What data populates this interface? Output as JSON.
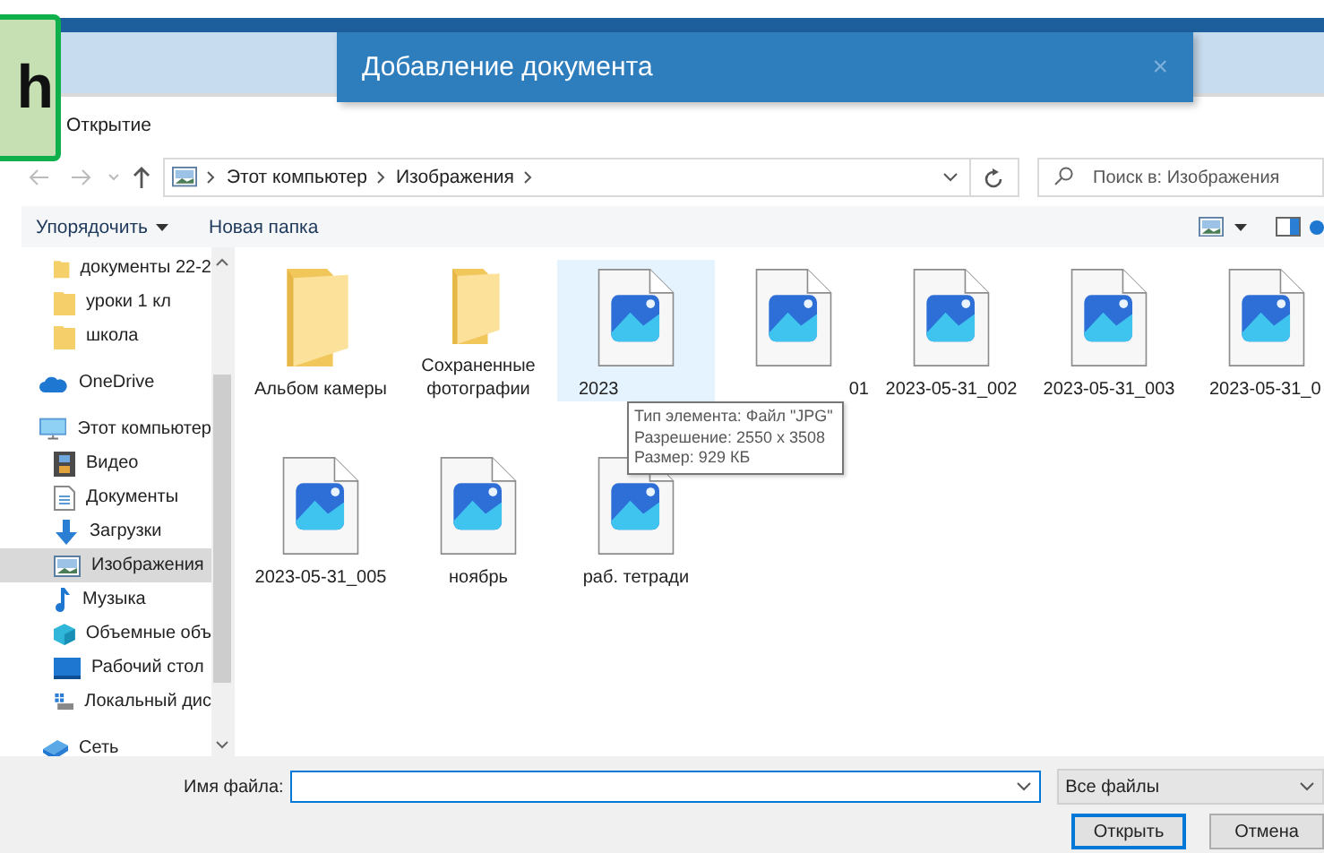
{
  "badge": {
    "text": "h"
  },
  "dialog": {
    "title": "Добавление документа",
    "close": "×"
  },
  "window": {
    "title": "Открытие"
  },
  "address": {
    "crumbs": [
      "Этот компьютер",
      "Изображения"
    ]
  },
  "search": {
    "placeholder": "Поиск в: Изображения"
  },
  "toolbar": {
    "organize": "Упорядочить",
    "new_folder": "Новая папка"
  },
  "sidebar": {
    "items": [
      {
        "kind": "group",
        "children": [
          {
            "label": "документы 22-2",
            "kind": "folder",
            "selected": false
          },
          {
            "label": "уроки 1 кл",
            "kind": "folder",
            "selected": false
          },
          {
            "label": "школа",
            "kind": "folder",
            "selected": false
          }
        ]
      },
      {
        "label": "OneDrive",
        "kind": "cloud",
        "selected": false
      },
      {
        "label": "Этот компьютер",
        "kind": "pc",
        "selected": false,
        "children": [
          {
            "label": "Видео",
            "kind": "video",
            "selected": false
          },
          {
            "label": "Документы",
            "kind": "docs",
            "selected": false
          },
          {
            "label": "Загрузки",
            "kind": "downloads",
            "selected": false
          },
          {
            "label": "Изображения",
            "kind": "pictures",
            "selected": true
          },
          {
            "label": "Музыка",
            "kind": "music",
            "selected": false
          },
          {
            "label": "Объемные объ",
            "kind": "cube",
            "selected": false
          },
          {
            "label": "Рабочий стол",
            "kind": "desktop",
            "selected": false
          },
          {
            "label": "Локальный дис",
            "kind": "disk",
            "selected": false
          }
        ]
      },
      {
        "label": "Сеть",
        "kind": "network",
        "selected": false
      }
    ]
  },
  "files": [
    {
      "label": {
        "text": "Альбом камеры",
        "kind": "center"
      },
      "kind": "folder",
      "highlighted": false
    },
    {
      "label": {
        "text": "Сохраненные фотографии",
        "kind": "center"
      },
      "kind": "folder",
      "highlighted": false
    },
    {
      "label": {
        "text": "2023",
        "kind": "left"
      },
      "kind": "image",
      "highlighted": true
    },
    {
      "label": {
        "text": "01",
        "kind": "right"
      },
      "kind": "image",
      "highlighted": false
    },
    {
      "label": {
        "text": "2023-05-31_002",
        "kind": "center"
      },
      "kind": "image",
      "highlighted": false
    },
    {
      "label": {
        "text": "2023-05-31_003",
        "kind": "center"
      },
      "kind": "image",
      "highlighted": false
    },
    {
      "label": {
        "text": "2023-05-31_0",
        "kind": "left"
      },
      "kind": "image",
      "highlighted": false
    },
    {
      "label": {
        "text": "2023-05-31_005",
        "kind": "center"
      },
      "kind": "image",
      "highlighted": false
    },
    {
      "label": {
        "text": "ноябрь",
        "kind": "center"
      },
      "kind": "image",
      "highlighted": false
    },
    {
      "label": {
        "text": "раб. тетради",
        "kind": "center"
      },
      "kind": "image",
      "highlighted": false
    }
  ],
  "tooltip": {
    "lines": [
      "Тип элемента: Файл \"JPG\"",
      "Разрешение: 2550 x 3508",
      "Размер: 929 КБ"
    ]
  },
  "footer": {
    "filename_label": "Имя файла:",
    "filter": "Все файлы",
    "buttons": [
      {
        "label": "Открыть",
        "default": true
      },
      {
        "label": "Отмена",
        "default": false
      }
    ]
  }
}
